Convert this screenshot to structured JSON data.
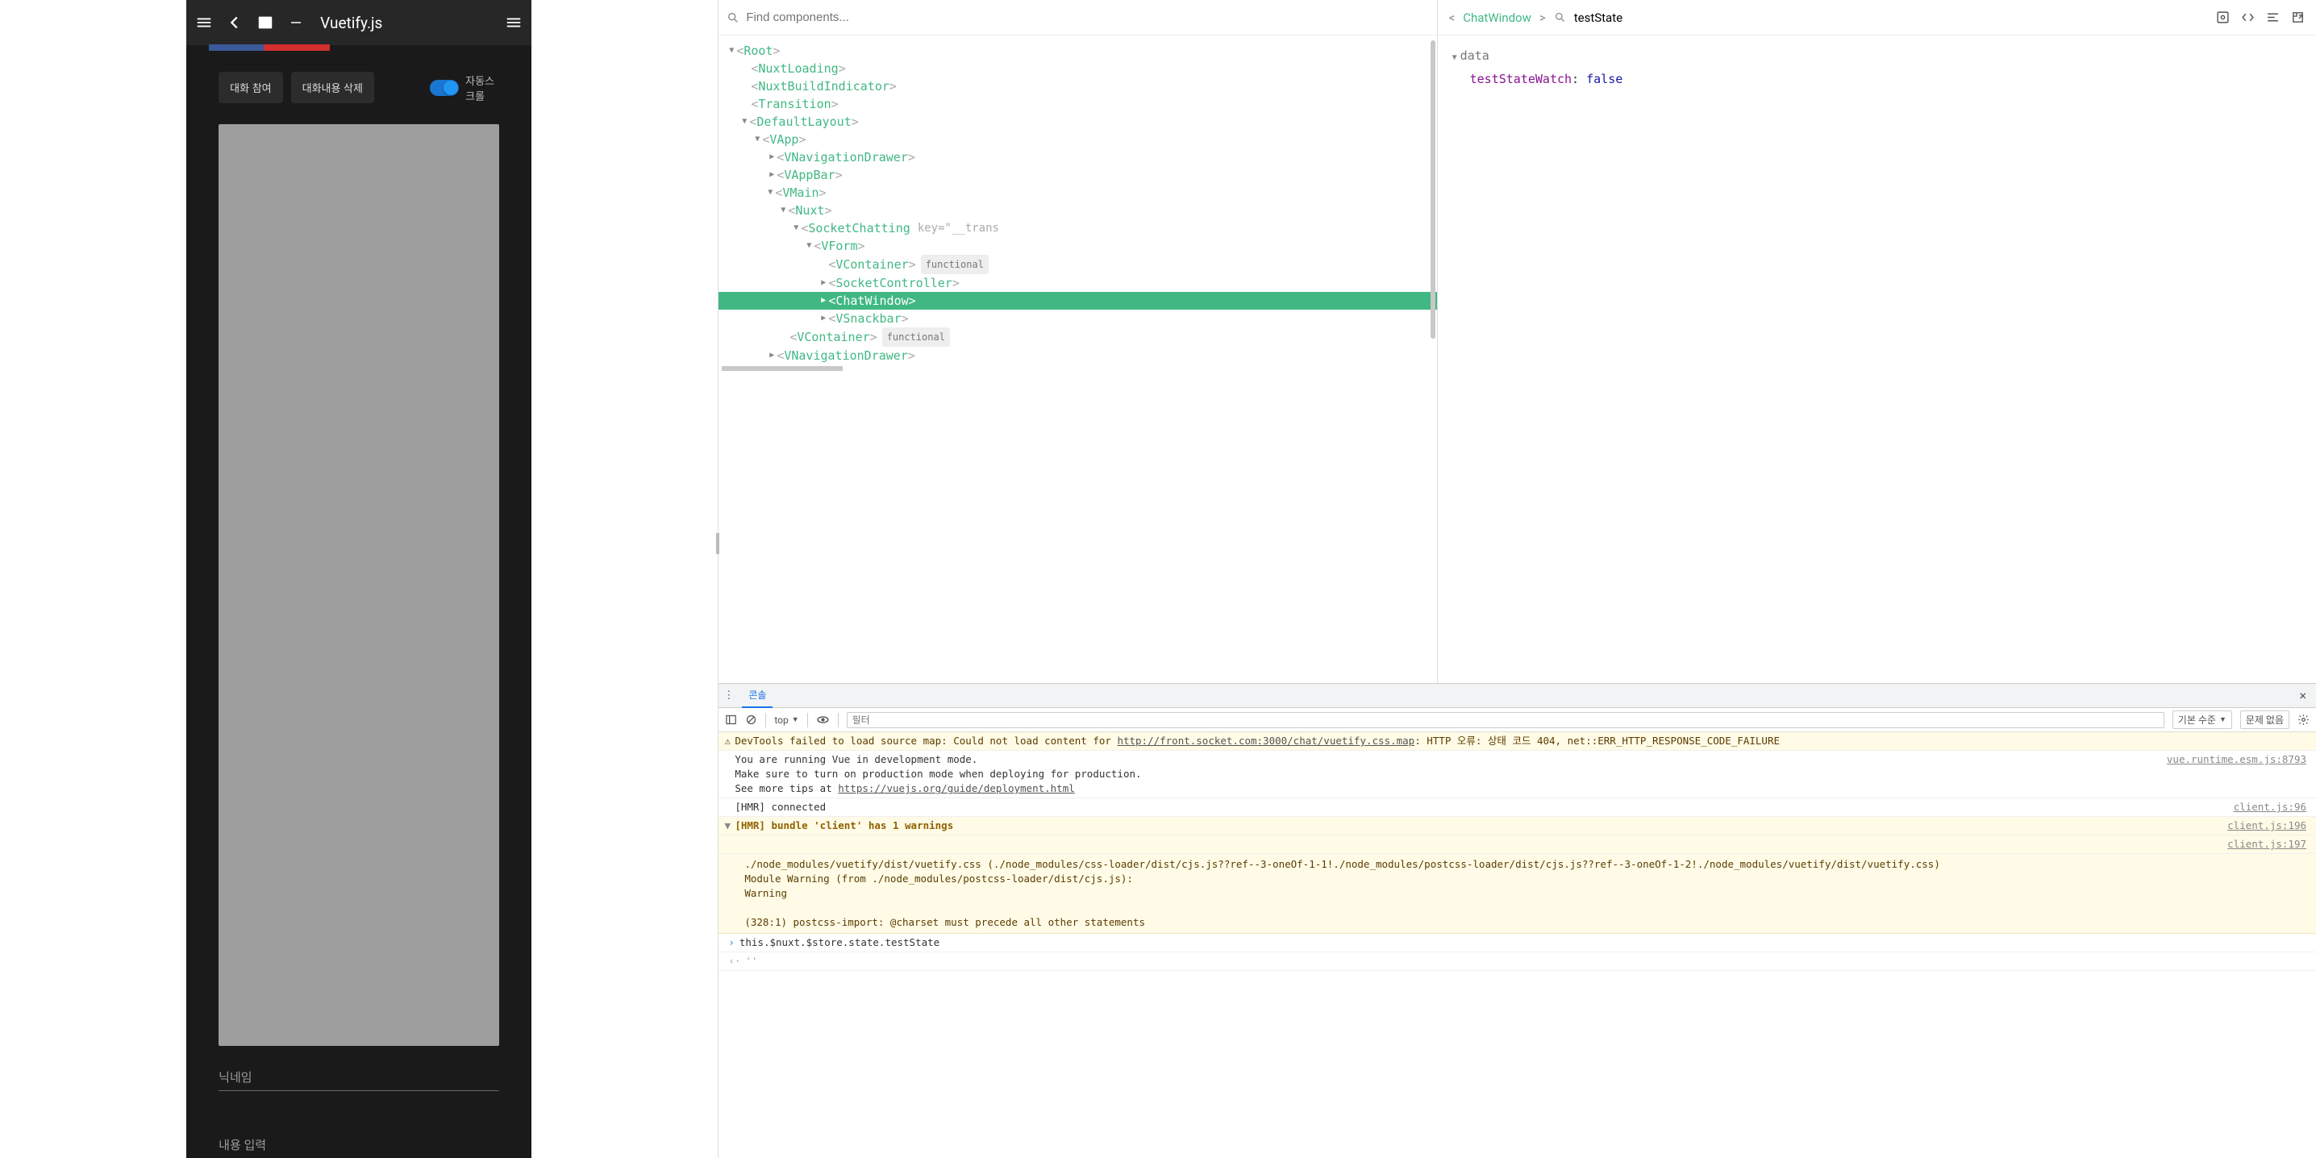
{
  "mobile": {
    "title": "Vuetify.js",
    "btn_join": "대화 참여",
    "btn_clear": "대화내용 삭제",
    "switch_label": "자동스크롤",
    "nickname_placeholder": "닉네임",
    "message_placeholder": "내용 입력"
  },
  "vue": {
    "search_placeholder": "Find components...",
    "breadcrumb": "ChatWindow",
    "filter_value": "testState",
    "tree": {
      "root": "Root",
      "nuxt_loading": "NuxtLoading",
      "nuxt_build": "NuxtBuildIndicator",
      "transition": "Transition",
      "default_layout": "DefaultLayout",
      "vapp": "VApp",
      "vnavdrawer": "VNavigationDrawer",
      "vappbar": "VAppBar",
      "vmain": "VMain",
      "nuxt": "Nuxt",
      "socket_chatting": "SocketChatting",
      "socket_key": "key=\"__trans",
      "vform": "VForm",
      "vcontainer": "VContainer",
      "functional": "functional",
      "socket_controller": "SocketController",
      "chat_window": "ChatWindow",
      "vsnackbar": "VSnackbar",
      "vcontainer2": "VContainer",
      "vnavdrawer2": "VNavigationDrawer"
    },
    "data_heading": "data",
    "data_key": "testStateWatch",
    "data_value": "false"
  },
  "console": {
    "tab": "콘솔",
    "context": "top",
    "filter_placeholder": "필터",
    "level_label": "기본 수준",
    "issues_label": "문제 없음",
    "warn1_pre": "DevTools failed to load source map: Could not load content for ",
    "warn1_url": "http://front.socket.com:3000/chat/vuetify.css.map",
    "warn1_post": ": HTTP 오류: 상태 코드 404, net::ERR_HTTP_RESPONSE_CODE_FAILURE",
    "vue_dev1": "You are running Vue in development mode.",
    "vue_dev2": "Make sure to turn on production mode when deploying for production.",
    "vue_dev3_pre": "See more tips at ",
    "vue_dev3_url": "https://vuejs.org/guide/deployment.html",
    "vue_src": "vue.runtime.esm.js:8793",
    "hmr_connected": "[HMR] connected",
    "hmr_connected_src": "client.js:96",
    "hmr_warn": "[HMR] bundle 'client' has 1 warnings",
    "hmr_warn_src": "client.js:196",
    "hmr_warn2_src": "client.js:197",
    "mod_warn1": "./node_modules/vuetify/dist/vuetify.css (./node_modules/css-loader/dist/cjs.js??ref--3-oneOf-1-1!./node_modules/postcss-loader/dist/cjs.js??ref--3-oneOf-1-2!./node_modules/vuetify/dist/vuetify.css)",
    "mod_warn2": "Module Warning (from ./node_modules/postcss-loader/dist/cjs.js):",
    "mod_warn3": "Warning",
    "mod_warn4": "(328:1) postcss-import: @charset must precede all other statements",
    "prompt": "this.$nuxt.$store.state.testState",
    "reply": "''"
  }
}
